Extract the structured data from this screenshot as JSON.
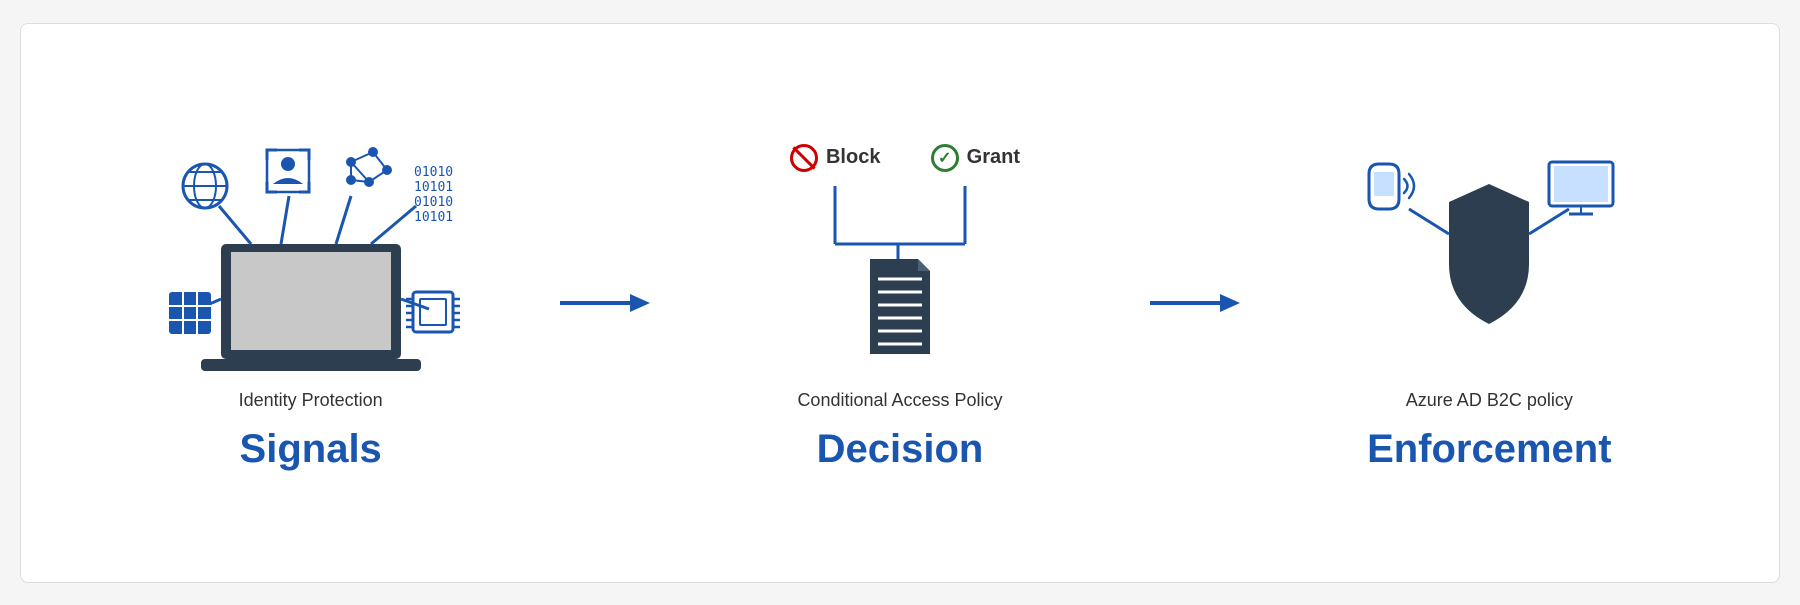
{
  "sections": [
    {
      "id": "signals",
      "sub_label": "Identity Protection",
      "main_label": "Signals"
    },
    {
      "id": "decision",
      "sub_label": "Conditional Access Policy",
      "main_label": "Decision",
      "block_text": "Block",
      "grant_text": "Grant"
    },
    {
      "id": "enforcement",
      "sub_label": "Azure AD B2C policy",
      "main_label": "Enforcement"
    }
  ],
  "binary_text": "01010\n10101\n01010\n10101",
  "arrow": "→"
}
